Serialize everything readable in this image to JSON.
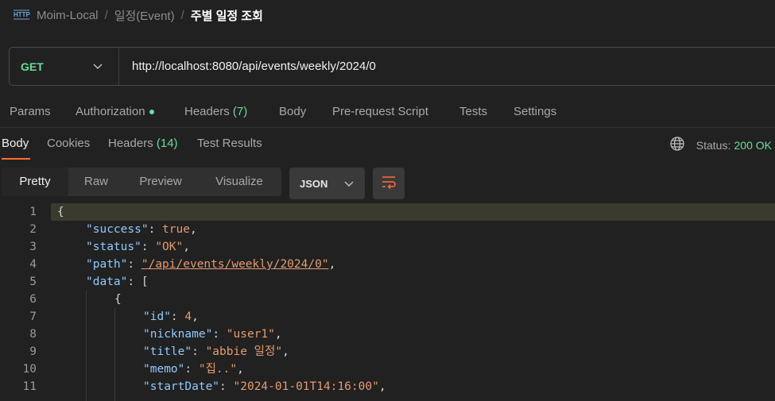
{
  "breadcrumb": {
    "icon": "http-file-icon",
    "collection": "Moim-Local",
    "folder": "일정(Event)",
    "request": "주별 일정 조회",
    "separator": "/"
  },
  "request": {
    "method": "GET",
    "url": "http://localhost:8080/api/events/weekly/2024/0"
  },
  "request_tabs": [
    {
      "label": "Params"
    },
    {
      "label": "Authorization",
      "indicator": "green-dot"
    },
    {
      "label": "Headers",
      "count": "(7)"
    },
    {
      "label": "Body"
    },
    {
      "label": "Pre-request Script"
    },
    {
      "label": "Tests"
    },
    {
      "label": "Settings"
    }
  ],
  "response_tabs": [
    {
      "label": "Body",
      "active": true
    },
    {
      "label": "Cookies"
    },
    {
      "label": "Headers",
      "count": "(14)"
    },
    {
      "label": "Test Results"
    }
  ],
  "status": {
    "label": "Status:",
    "value": "200 OK",
    "icon": "globe-icon"
  },
  "view_modes": [
    {
      "label": "Pretty",
      "active": true
    },
    {
      "label": "Raw"
    },
    {
      "label": "Preview"
    },
    {
      "label": "Visualize"
    }
  ],
  "format": {
    "selected": "JSON"
  },
  "colors": {
    "accent": "#ff6c37",
    "success": "#6bdd9a",
    "key": "#8fc9ff",
    "string": "#e59a70"
  },
  "code_lines": [
    {
      "n": "1",
      "text": "{"
    },
    {
      "n": "2",
      "key": "\"success\"",
      "value": "true",
      "tail": ","
    },
    {
      "n": "3",
      "key": "\"status\"",
      "value": "\"OK\"",
      "tail": ","
    },
    {
      "n": "4",
      "key": "\"path\"",
      "value": "\"/api/events/weekly/2024/0\"",
      "tail": ","
    },
    {
      "n": "5",
      "key": "\"data\"",
      "value": "[",
      "tail": ""
    },
    {
      "n": "6",
      "text": "{"
    },
    {
      "n": "7",
      "key": "\"id\"",
      "value": "4",
      "tail": ","
    },
    {
      "n": "8",
      "key": "\"nickname\"",
      "value": "\"user1\"",
      "tail": ","
    },
    {
      "n": "9",
      "key": "\"title\"",
      "value": "\"abbie 일정\"",
      "tail": ","
    },
    {
      "n": "10",
      "key": "\"memo\"",
      "value": "\"집..\"",
      "tail": ","
    },
    {
      "n": "11",
      "key": "\"startDate\"",
      "value": "\"2024-01-01T14:16:00\"",
      "tail": ","
    }
  ]
}
